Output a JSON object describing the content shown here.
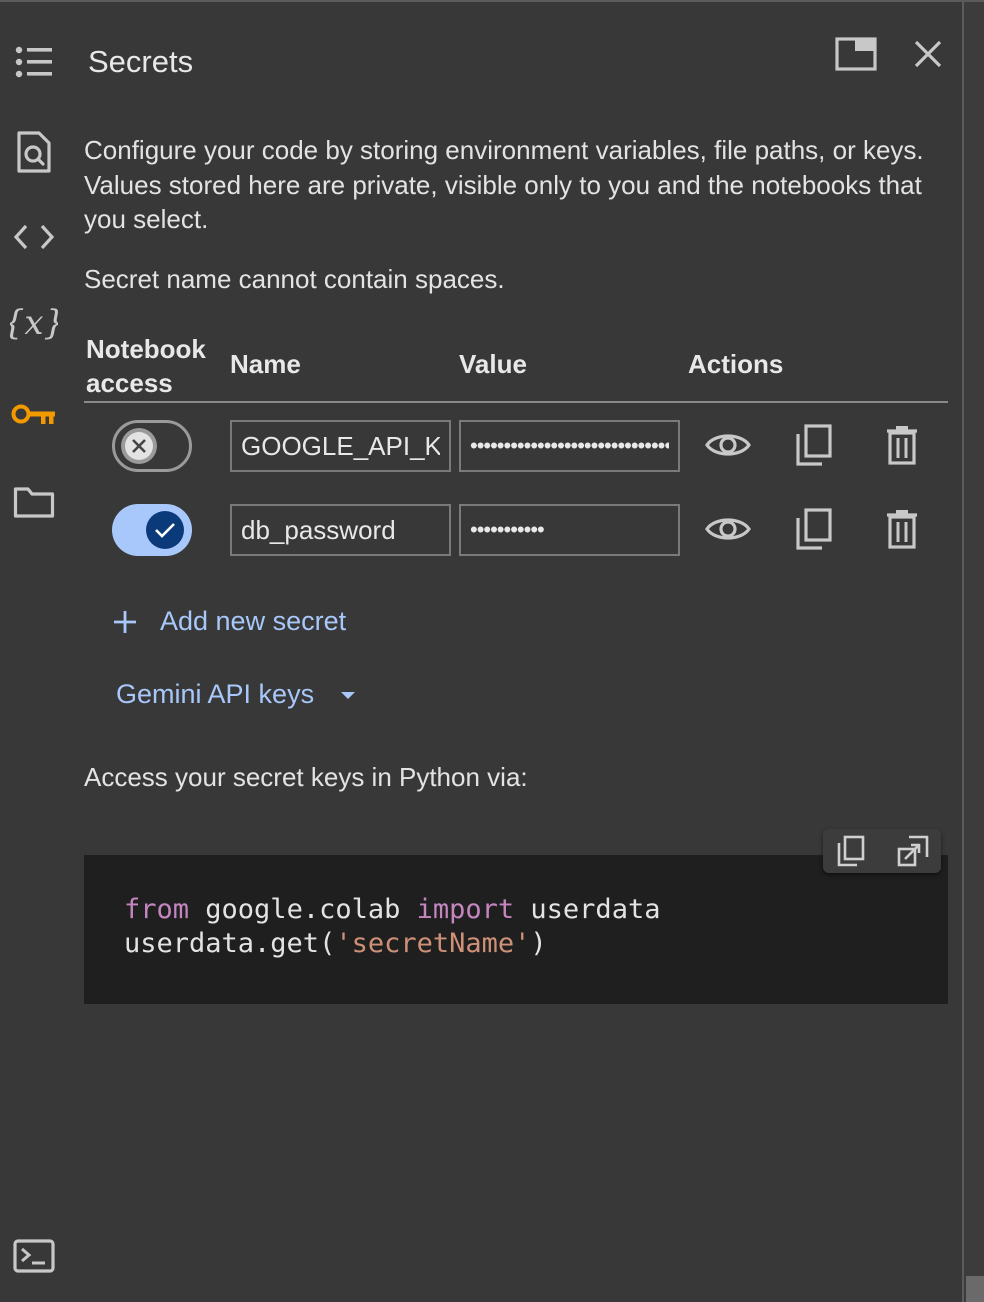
{
  "panel": {
    "title": "Secrets",
    "description": "Configure your code by storing environment variables, file paths, or keys. Values stored here are private, visible only to you and the notebooks that you select.",
    "note": "Secret name cannot contain spaces."
  },
  "rail": {
    "icons": [
      "table-of-contents-icon",
      "find-replace-icon",
      "code-snippets-icon",
      "variables-icon",
      "key-icon",
      "folder-icon",
      "terminal-icon"
    ],
    "active": "key-icon",
    "active_color": "#f29900"
  },
  "table": {
    "headers": {
      "access_line1": "Notebook",
      "access_line2": "access",
      "name": "Name",
      "value": "Value",
      "actions": "Actions"
    },
    "rows": [
      {
        "access_enabled": false,
        "name": "GOOGLE_API_KEY",
        "value": "••••••••••••••••••••••••••••••••••••••••"
      },
      {
        "access_enabled": true,
        "name": "db_password",
        "value": "•••••••••••"
      }
    ]
  },
  "add_secret_label": "Add new secret",
  "gemini_label": "Gemini API keys",
  "access_text": "Access your secret keys in Python via:",
  "code": {
    "line1": {
      "kw1": "from",
      "mod": " google.colab ",
      "kw2": "import",
      "name": " userdata"
    },
    "line2": {
      "call": "userdata.get(",
      "arg": "'secretName'",
      "close": ")"
    }
  },
  "colors": {
    "background": "#383838",
    "link": "#a8c7fa",
    "toggle_on": "#a8c7fa",
    "code_bg": "#1f1f1f",
    "keyword": "#c586c0",
    "string": "#ce9178"
  }
}
